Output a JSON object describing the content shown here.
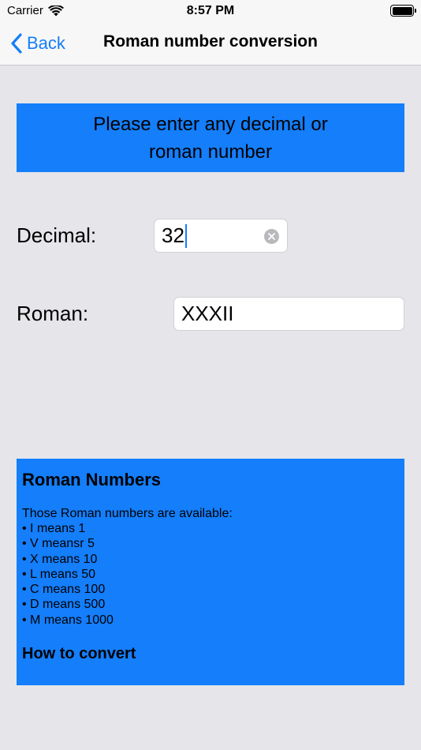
{
  "status_bar": {
    "carrier": "Carrier",
    "time": "8:57 PM",
    "wifi_icon": "wifi-icon",
    "battery_icon": "battery-icon",
    "battery_level": 1.0
  },
  "nav": {
    "back_label": "Back",
    "back_icon": "chevron-left-icon",
    "title": "Roman number conversion"
  },
  "prompt": {
    "line1": "Please enter any decimal or",
    "line2": "roman number"
  },
  "form": {
    "decimal_label": "Decimal:",
    "decimal_value": "32",
    "roman_label": "Roman:",
    "roman_value": "XXXII"
  },
  "info": {
    "heading": "Roman Numbers",
    "intro": "Those Roman numbers are available:",
    "items": [
      "I means 1",
      "V meansr 5",
      "X means 10",
      "L means 50",
      "C means 100",
      "D means 500",
      "M means 1000"
    ],
    "subheading": "How to convert"
  },
  "colors": {
    "accent": "#147efb",
    "background": "#e5e5ea",
    "navbar": "#f7f7f7"
  }
}
